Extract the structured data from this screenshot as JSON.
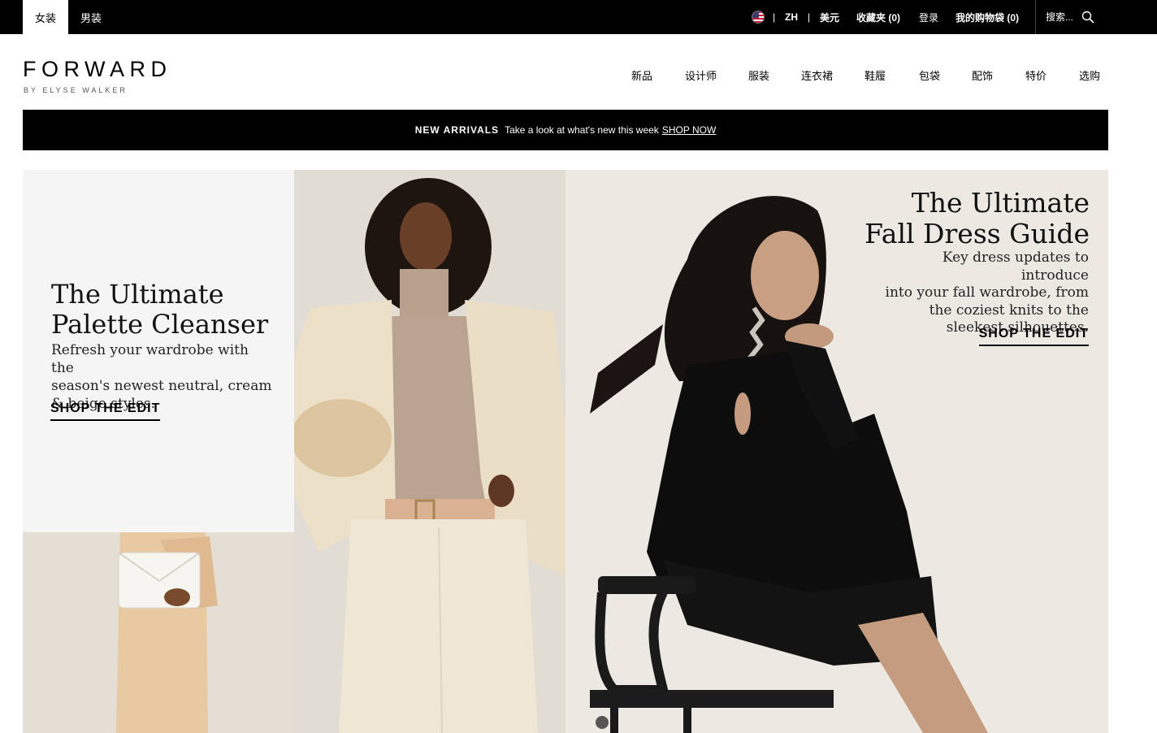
{
  "topbar": {
    "gender_tabs": [
      {
        "label": "女装",
        "active": true
      },
      {
        "label": "男装",
        "active": false
      }
    ],
    "flag_icon": "us-flag-icon",
    "language": "ZH",
    "separator": "|",
    "currency": "美元",
    "wishlist": "收藏夹 (0)",
    "login": "登录",
    "cart": "我的购物袋 (0)",
    "search": {
      "placeholder": "搜索..."
    }
  },
  "brand": {
    "logo": "FORWARD",
    "logo_sub": "BY ELYSE WALKER"
  },
  "nav": {
    "items": [
      "新品",
      "设计师",
      "服装",
      "连衣裙",
      "鞋履",
      "包袋",
      "配饰",
      "特价",
      "选购"
    ]
  },
  "promo": {
    "title": "NEW ARRIVALS",
    "text": "Take a look at what's new this week",
    "link": "SHOP NOW"
  },
  "hero": {
    "left": {
      "title_line1": "The Ultimate",
      "title_line2": "Palette Cleanser",
      "desc_line1": "Refresh your wardrobe with the",
      "desc_line2": "season's newest neutral, cream",
      "desc_line3": "& beige styles.",
      "cta": "SHOP THE EDIT"
    },
    "right": {
      "title_line1": "The Ultimate",
      "title_line2": "Fall Dress Guide",
      "desc_line1": "Key dress updates to introduce",
      "desc_line2": "into your fall wardrobe, from",
      "desc_line3": "the coziest knits to the",
      "desc_line4": "sleekest silhouettes.",
      "cta": "SHOP THE EDIT"
    }
  },
  "colors": {
    "topbar_bg": "#000000",
    "promo_bg": "#000000",
    "text": "#000000"
  }
}
